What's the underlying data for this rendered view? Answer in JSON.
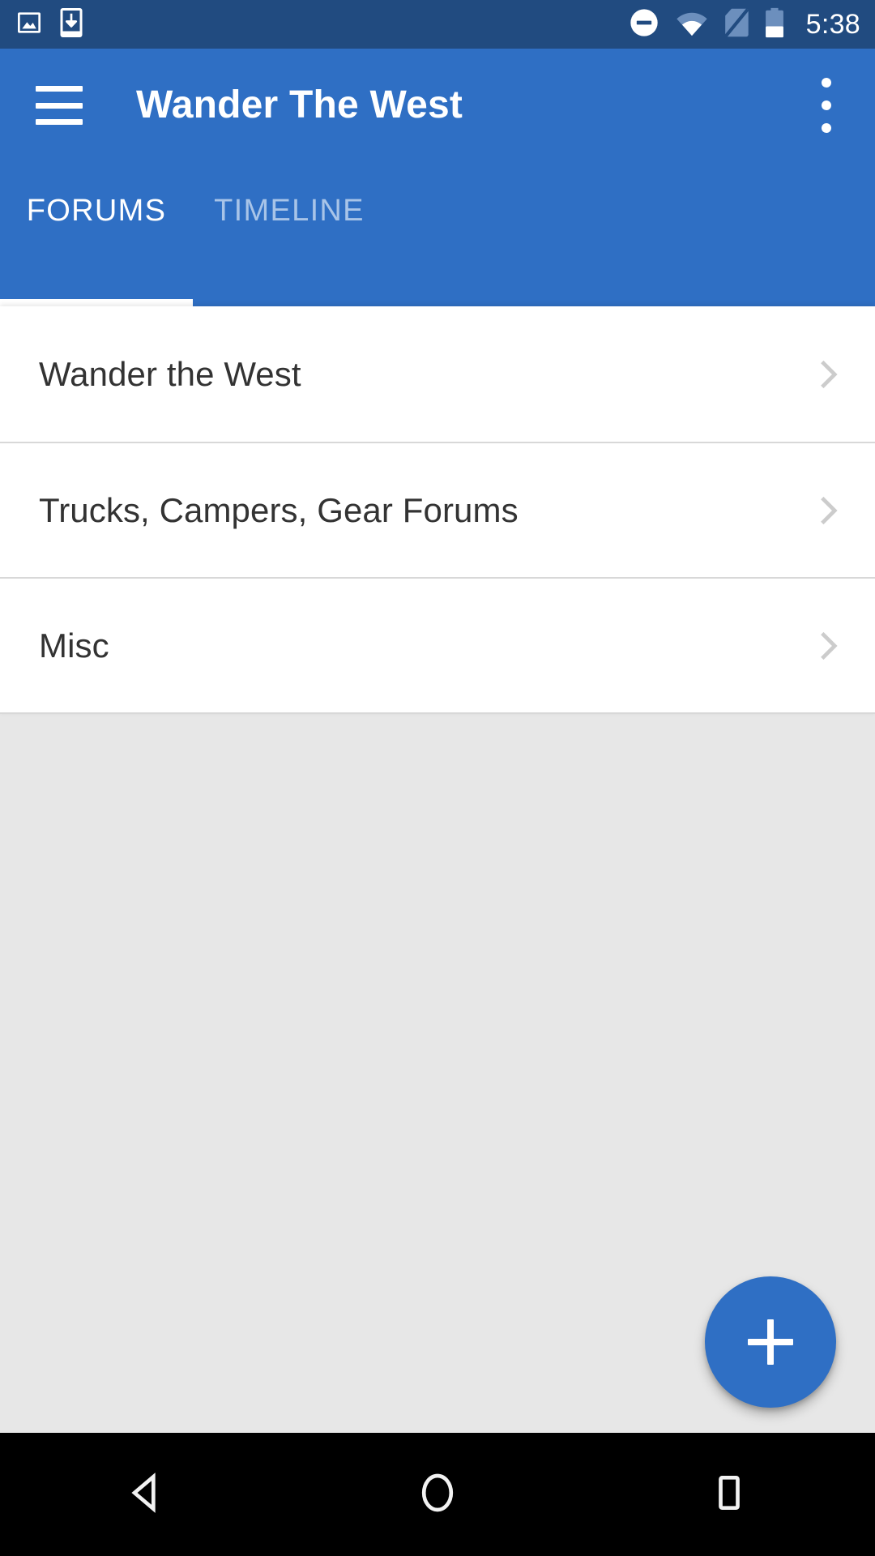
{
  "status_bar": {
    "background": "#214b80",
    "time": "5:38",
    "left_icons": [
      {
        "name": "image-icon",
        "label": "Screenshot saved"
      },
      {
        "name": "download-icon",
        "label": "Download complete"
      }
    ],
    "right_icons": [
      {
        "name": "do-not-disturb-icon",
        "label": "Do not disturb"
      },
      {
        "name": "wifi-icon",
        "label": "Wi-Fi connected"
      },
      {
        "name": "no-sim-icon",
        "label": "No SIM card"
      },
      {
        "name": "battery-icon",
        "label": "Battery"
      }
    ]
  },
  "app_bar": {
    "background": "#2f6fc4",
    "title": "Wander The West",
    "menu_icon": "hamburger-menu-icon",
    "overflow_icon": "overflow-menu-icon"
  },
  "tabs": {
    "active_index": 0,
    "indicator_color": "#ffffff",
    "items": [
      {
        "label": "FORUMS",
        "active": true
      },
      {
        "label": "TIMELINE",
        "active": false
      }
    ]
  },
  "forum_list": {
    "background": "#ffffff",
    "divider_color": "#d8d8d8",
    "items": [
      {
        "label": "Wander the West",
        "chevron": "chevron-right-icon"
      },
      {
        "label": "Trucks, Campers, Gear Forums",
        "chevron": "chevron-right-icon"
      },
      {
        "label": "Misc",
        "chevron": "chevron-right-icon"
      }
    ]
  },
  "content_area": {
    "background": "#e7e7e7"
  },
  "fab": {
    "label": "+",
    "icon": "plus-icon",
    "color": "#2f6fc4",
    "icon_color": "#ffffff"
  },
  "nav_bar": {
    "background": "#000000",
    "buttons": [
      {
        "name": "back-button",
        "icon": "back-triangle-icon"
      },
      {
        "name": "home-button",
        "icon": "home-circle-icon"
      },
      {
        "name": "recents-button",
        "icon": "recents-square-icon"
      }
    ]
  }
}
